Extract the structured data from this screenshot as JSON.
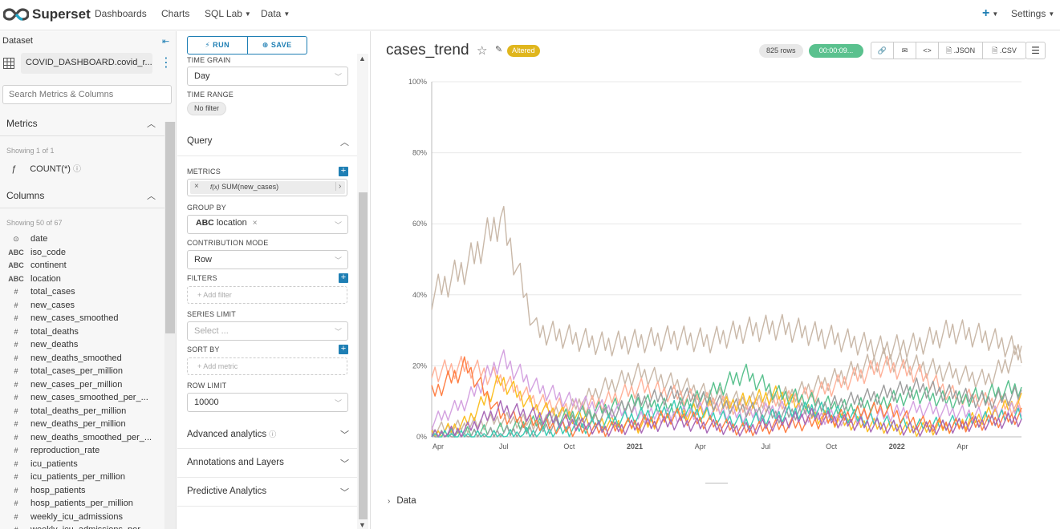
{
  "nav": {
    "brand": "Superset",
    "links": [
      {
        "label": "Dashboards",
        "dropdown": false
      },
      {
        "label": "Charts",
        "dropdown": false
      },
      {
        "label": "SQL Lab",
        "dropdown": true
      },
      {
        "label": "Data",
        "dropdown": true
      }
    ],
    "plus_icon": "plus-icon",
    "settings_label": "Settings"
  },
  "dataset": {
    "title": "Dataset",
    "name": "COVID_DASHBOARD.covid_r...",
    "search_placeholder": "Search Metrics & Columns",
    "metrics_title": "Metrics",
    "metrics_showing": "Showing 1 of 1",
    "metrics": [
      {
        "type": "ƒ",
        "name": "COUNT(*)",
        "help_icon": "question-circle-icon"
      }
    ],
    "columns_title": "Columns",
    "columns_showing": "Showing 50 of 67",
    "columns": [
      {
        "type": "clock",
        "name": "date"
      },
      {
        "type": "ABC",
        "name": "iso_code"
      },
      {
        "type": "ABC",
        "name": "continent"
      },
      {
        "type": "ABC",
        "name": "location"
      },
      {
        "type": "#",
        "name": "total_cases"
      },
      {
        "type": "#",
        "name": "new_cases"
      },
      {
        "type": "#",
        "name": "new_cases_smoothed"
      },
      {
        "type": "#",
        "name": "total_deaths"
      },
      {
        "type": "#",
        "name": "new_deaths"
      },
      {
        "type": "#",
        "name": "new_deaths_smoothed"
      },
      {
        "type": "#",
        "name": "total_cases_per_million"
      },
      {
        "type": "#",
        "name": "new_cases_per_million"
      },
      {
        "type": "#",
        "name": "new_cases_smoothed_per_..."
      },
      {
        "type": "#",
        "name": "total_deaths_per_million"
      },
      {
        "type": "#",
        "name": "new_deaths_per_million"
      },
      {
        "type": "#",
        "name": "new_deaths_smoothed_per_..."
      },
      {
        "type": "#",
        "name": "reproduction_rate"
      },
      {
        "type": "#",
        "name": "icu_patients"
      },
      {
        "type": "#",
        "name": "icu_patients_per_million"
      },
      {
        "type": "#",
        "name": "hosp_patients"
      },
      {
        "type": "#",
        "name": "hosp_patients_per_million"
      },
      {
        "type": "#",
        "name": "weekly_icu_admissions"
      },
      {
        "type": "#",
        "name": "weekly_icu_admissions_per_..."
      }
    ]
  },
  "controls": {
    "run_label": "RUN",
    "save_label": "SAVE",
    "time_grain_label": "TIME GRAIN",
    "time_grain_value": "Day",
    "time_range_label": "TIME RANGE",
    "time_range_value": "No filter",
    "query_title": "Query",
    "metrics_label": "METRICS",
    "metric_value": "SUM(new_cases)",
    "group_by_label": "GROUP BY",
    "group_by_type": "ABC",
    "group_by_value": "location",
    "contribution_label": "CONTRIBUTION MODE",
    "contribution_value": "Row",
    "filters_label": "FILTERS",
    "add_filter": "Add filter",
    "series_limit_label": "SERIES LIMIT",
    "series_limit_placeholder": "Select ...",
    "sort_by_label": "SORT BY",
    "add_metric": "Add metric",
    "row_limit_label": "ROW LIMIT",
    "row_limit_value": "10000",
    "advanced_title": "Advanced analytics",
    "annotations_title": "Annotations and Layers",
    "predictive_title": "Predictive Analytics"
  },
  "chart_header": {
    "title": "cases_trend",
    "altered": "Altered",
    "rows": "825 rows",
    "timer": "00:00:09...",
    "json_label": ".JSON",
    "csv_label": ".CSV"
  },
  "chart_data": {
    "type": "line",
    "y_ticks": [
      "100%",
      "80%",
      "60%",
      "40%",
      "20%",
      "0%"
    ],
    "ylim": [
      0,
      100
    ],
    "x_ticks": [
      {
        "label": "Apr",
        "bold": false
      },
      {
        "label": "Jul",
        "bold": false
      },
      {
        "label": "Oct",
        "bold": false
      },
      {
        "label": "2021",
        "bold": true
      },
      {
        "label": "Apr",
        "bold": false
      },
      {
        "label": "Jul",
        "bold": false
      },
      {
        "label": "Oct",
        "bold": false
      },
      {
        "label": "2022",
        "bold": true
      },
      {
        "label": "Apr",
        "bold": false
      }
    ],
    "x_range": [
      "2020-03-20",
      "2022-06-20"
    ],
    "series": [
      {
        "color": "#c9b8a8",
        "values": [
          40,
          48,
          62,
          30,
          28,
          26,
          27,
          28,
          27,
          30,
          31,
          29,
          27,
          25,
          26,
          30,
          28,
          24
        ]
      },
      {
        "color": "#c9b8a8",
        "values": [
          2,
          3,
          5,
          4,
          8,
          14,
          18,
          15,
          12,
          10,
          11,
          14,
          18,
          22,
          20,
          18,
          16,
          24
        ]
      },
      {
        "color": "#ffb199",
        "values": [
          18,
          20,
          16,
          10,
          8,
          10,
          14,
          12,
          10,
          8,
          10,
          12,
          16,
          20,
          18,
          12,
          10,
          8
        ]
      },
      {
        "color": "#fbbf24",
        "values": [
          0,
          4,
          16,
          8,
          6,
          4,
          3,
          6,
          8,
          10,
          12,
          6,
          4,
          3,
          2,
          3,
          6,
          10
        ]
      },
      {
        "color": "#5ac18e",
        "values": [
          0,
          1,
          2,
          4,
          6,
          8,
          10,
          8,
          12,
          18,
          12,
          10,
          8,
          10,
          12,
          10,
          12,
          14
        ]
      },
      {
        "color": "#d4a2e0",
        "values": [
          4,
          10,
          22,
          14,
          10,
          8,
          6,
          6,
          8,
          6,
          8,
          6,
          5,
          6,
          8,
          7,
          6,
          8
        ]
      },
      {
        "color": "#9e9e9e",
        "values": [
          0,
          0,
          1,
          2,
          4,
          6,
          10,
          12,
          10,
          8,
          6,
          8,
          10,
          12,
          14,
          12,
          10,
          12
        ]
      },
      {
        "color": "#3cccb4",
        "values": [
          0,
          0,
          0,
          1,
          2,
          4,
          6,
          8,
          6,
          4,
          6,
          8,
          6,
          4,
          3,
          4,
          5,
          6
        ]
      },
      {
        "color": "#ff7f44",
        "values": [
          12,
          20,
          6,
          4,
          2,
          2,
          4,
          6,
          4,
          2,
          3,
          4,
          6,
          8,
          4,
          3,
          4,
          6
        ]
      },
      {
        "color": "#a868b7",
        "values": [
          0,
          2,
          8,
          6,
          4,
          2,
          3,
          4,
          3,
          2,
          4,
          6,
          4,
          3,
          2,
          3,
          4,
          5
        ]
      }
    ]
  },
  "data_section": {
    "label": "Data"
  }
}
